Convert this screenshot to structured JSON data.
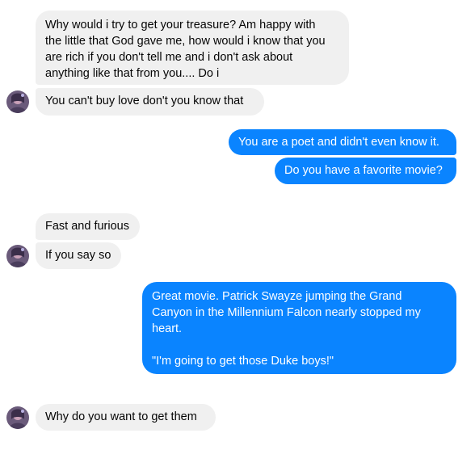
{
  "messages": [
    {
      "side": "in",
      "lines": [
        "Why would i try to get your treasure? Am happy with",
        "the little that God gave me, how would i know that you",
        "are rich if you don't tell me and i don't ask about",
        "anything like that from you.... Do i"
      ]
    },
    {
      "side": "in",
      "lines": [
        "You can't buy love don't you know that"
      ]
    },
    {
      "side": "out",
      "lines": [
        "You are a poet and didn't even know it."
      ]
    },
    {
      "side": "out",
      "lines": [
        "Do you have a favorite movie?"
      ]
    },
    {
      "side": "in",
      "lines": [
        "Fast and furious"
      ]
    },
    {
      "side": "in",
      "lines": [
        "If you say so"
      ]
    },
    {
      "side": "out",
      "lines": [
        "Great movie. Patrick Swayze jumping the Grand",
        "Canyon in the Millennium Falcon nearly stopped my",
        "heart.",
        "",
        "\"I'm going to get those Duke boys!\""
      ]
    },
    {
      "side": "in",
      "lines": [
        "Why do you want to get them"
      ]
    }
  ],
  "avatar": {
    "icon": "contact-avatar-icon"
  },
  "colors": {
    "incoming_bg": "#f0f0f0",
    "outgoing_bg": "#0a84ff",
    "incoming_text": "#050505",
    "outgoing_text": "#ffffff"
  }
}
